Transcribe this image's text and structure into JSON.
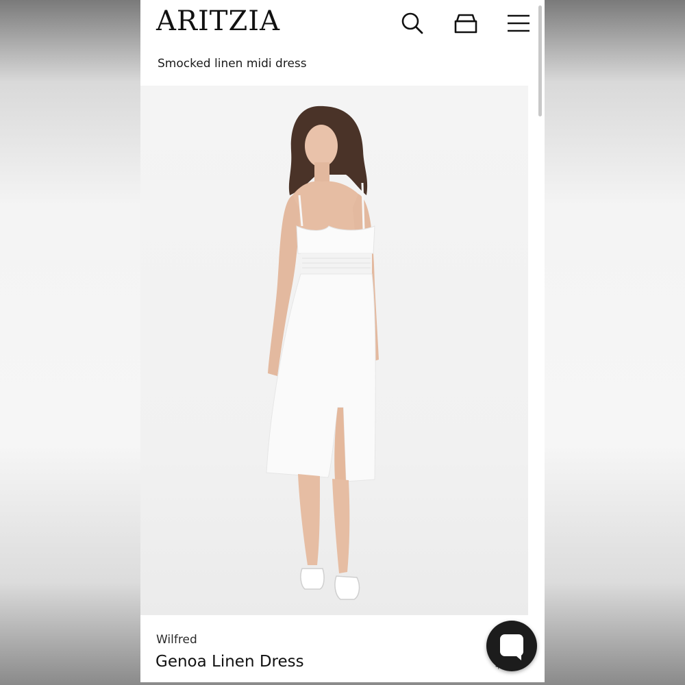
{
  "header": {
    "logo": "ARITZIA",
    "icons": [
      "search-icon",
      "shopping-bag-icon",
      "hamburger-menu-icon"
    ]
  },
  "page": {
    "subtitle": "Smocked linen midi dress"
  },
  "product": {
    "brand": "Wilfred",
    "name": "Genoa Linen Dress",
    "price": "$???",
    "image_alt": "Model wearing white smocked linen midi dress with front slit and white sandals"
  },
  "chat": {
    "icon": "chat-bubble-icon"
  },
  "colors": {
    "background": "#ffffff",
    "text": "#111111",
    "chat_button": "#1c1c1c"
  }
}
